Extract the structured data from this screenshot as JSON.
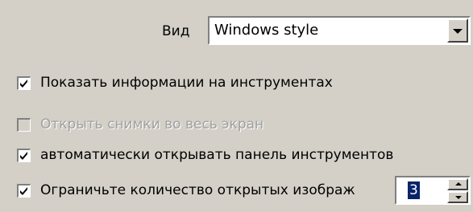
{
  "view": {
    "label": "Вид",
    "selected": "Windows style"
  },
  "options": [
    {
      "label": "Показать информации на инструментах",
      "checked": true,
      "enabled": true
    },
    {
      "label": "Открыть снимки во весь экран",
      "checked": false,
      "enabled": false
    },
    {
      "label": "автоматически открывать панель инструментов",
      "checked": true,
      "enabled": true
    },
    {
      "label": "Ограничьте количество открытых изображ",
      "checked": true,
      "enabled": true
    }
  ],
  "limit_spinner": {
    "value": "3"
  },
  "colors": {
    "background": "#d4d0c8",
    "selection": "#0a246a",
    "disabled_text": "#a0a0a0"
  },
  "icons": {
    "dropdown": "chevron-down-icon",
    "spin_up": "arrow-up-icon",
    "spin_down": "arrow-down-icon",
    "check": "checkmark-icon"
  }
}
